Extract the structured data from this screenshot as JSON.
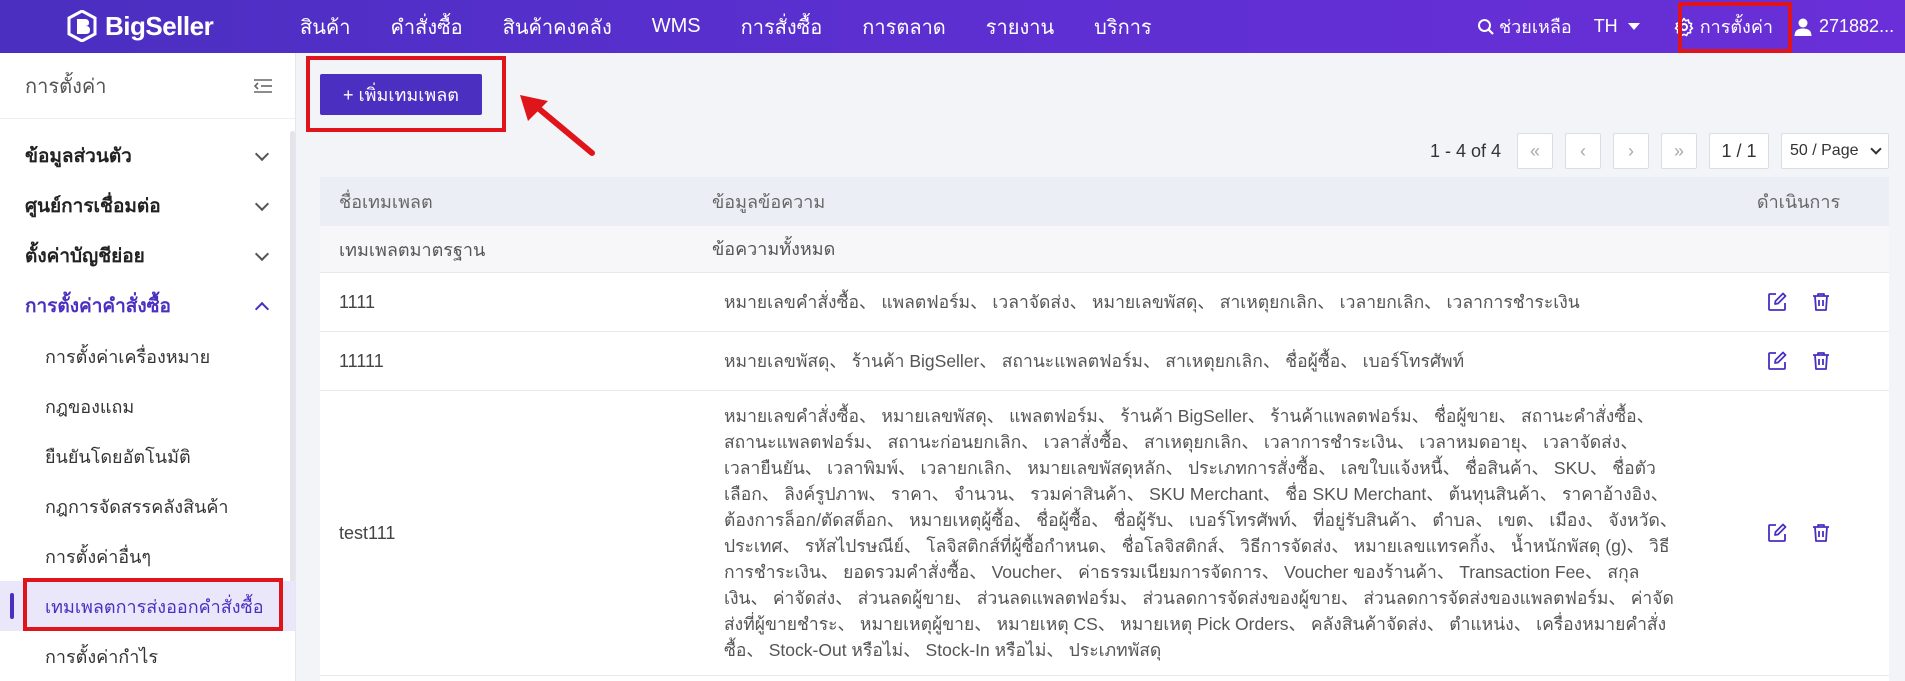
{
  "brand": {
    "name": "BigSeller",
    "accent": "#4a2fc0",
    "highlight": "#e0151c"
  },
  "nav": {
    "items": [
      "สินค้า",
      "คำสั่งซื้อ",
      "สินค้าคงคลัง",
      "WMS",
      "การสั่งซื้อ",
      "การตลาด",
      "รายงาน",
      "บริการ"
    ],
    "help": "ช่วยเหลือ",
    "lang": "TH",
    "settings": "การตั้งค่า",
    "user": "271882..."
  },
  "sidebar": {
    "title": "การตั้งค่า",
    "groups": [
      {
        "label": "ข้อมูลส่วนตัว"
      },
      {
        "label": "ศูนย์การเชื่อมต่อ"
      },
      {
        "label": "ตั้งค่าบัญชีย่อย"
      },
      {
        "label": "การตั้งค่าคำสั่งซื้อ"
      }
    ],
    "sub_items": [
      {
        "label": "การตั้งค่าเครื่องหมาย"
      },
      {
        "label": "กฎของแถม"
      },
      {
        "label": "ยืนยันโดยอัตโนมัติ"
      },
      {
        "label": "กฎการจัดสรรคลังสินค้า"
      },
      {
        "label": "การตั้งค่าอื่นๆ"
      },
      {
        "label": "เทมเพลตการส่งออกคำสั่งซื้อ"
      },
      {
        "label": "การตั้งค่ากำไร"
      }
    ]
  },
  "toolbar": {
    "add_label": "+ เพิ่มเทมเพลต"
  },
  "pagination": {
    "info": "1 - 4 of 4",
    "first": "«",
    "prev": "‹",
    "next": "›",
    "last": "»",
    "page": "1 / 1",
    "page_size": "50 / Page"
  },
  "table": {
    "headers": {
      "name": "ชื่อเทมเพลต",
      "message": "ข้อมูลข้อความ",
      "actions": "ดำเนินการ"
    },
    "standard": {
      "name": "เทมเพลตมาตรฐาน",
      "message": "ข้อความทั้งหมด"
    },
    "rows": [
      {
        "name": "1111",
        "message": "หมายเลขคำสั่งซื้อ、 แพลตฟอร์ม、 เวลาจัดส่ง、 หมายเลขพัสดุ、 สาเหตุยกเลิก、 เวลายกเลิก、 เวลาการชำระเงิน"
      },
      {
        "name": "11111",
        "message": "หมายเลขพัสดุ、 ร้านค้า BigSeller、 สถานะแพลตฟอร์ม、 สาเหตุยกเลิก、 ชื่อผู้ซื้อ、 เบอร์โทรศัพท์"
      },
      {
        "name": "test111",
        "message": "หมายเลขคำสั่งซื้อ、 หมายเลขพัสดุ、 แพลตฟอร์ม、 ร้านค้า BigSeller、 ร้านค้าแพลตฟอร์ม、 ชื่อผู้ขาย、 สถานะคำสั่งซื้อ、 สถานะแพลตฟอร์ม、 สถานะก่อนยกเลิก、 เวลาสั่งซื้อ、 สาเหตุยกเลิก、 เวลาการชำระเงิน、 เวลาหมดอายุ、 เวลาจัดส่ง、 เวลายืนยัน、 เวลาพิมพ์、 เวลายกเลิก、 หมายเลขพัสดุหลัก、 ประเภทการสั่งซื้อ、 เลขใบแจ้งหนี้、 ชื่อสินค้า、 SKU、 ชื่อตัวเลือก、 ลิงค์รูปภาพ、 ราคา、 จำนวน、 รวมค่าสินค้า、 SKU Merchant、 ชื่อ SKU Merchant、 ต้นทุนสินค้า、 ราคาอ้างอิง、 ต้องการล็อก/ตัดสต็อก、 หมายเหตุผู้ซื้อ、 ชื่อผู้ซื้อ、 ชื่อผู้รับ、 เบอร์โทรศัพท์、 ที่อยู่รับสินค้า、 ตำบล、 เขต、 เมือง、 จังหวัด、 ประเทศ、 รหัสไปรษณีย์、 โลจิสติกส์ที่ผู้ซื้อกำหนด、 ชื่อโลจิสติกส์、 วิธีการจัดส่ง、 หมายเลขแทรคกิ้ง、 น้ำหนักพัสดุ (g)、 วิธีการชำระเงิน、 ยอดรวมคำสั่งซื้อ、 Voucher、 ค่าธรรมเนียมการจัดการ、 Voucher ของร้านค้า、 Transaction Fee、 สกุลเงิน、 ค่าจัดส่ง、 ส่วนลดผู้ขาย、 ส่วนลดแพลตฟอร์ม、 ส่วนลดการจัดส่งของผู้ขาย、 ส่วนลดการจัดส่งของแพลตฟอร์ม、 ค่าจัดส่งที่ผู้ขายชำระ、 หมายเหตุผู้ขาย、 หมายเหตุ CS、 หมายเหตุ Pick Orders、 คลังสินค้าจัดส่ง、 ตำแหน่ง、 เครื่องหมายคำสั่งซื้อ、 Stock-Out หรือไม่、 Stock-In หรือไม่、 ประเภทพัสดุ"
      }
    ]
  },
  "icons": {
    "edit": "edit-icon",
    "delete": "trash-icon",
    "search": "search-icon",
    "gear": "gear-icon",
    "user": "user-icon"
  }
}
